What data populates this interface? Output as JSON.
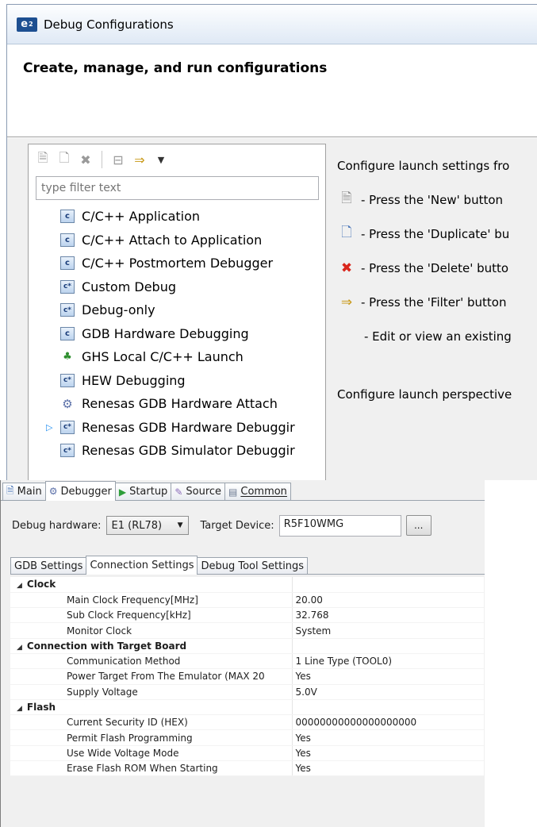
{
  "dialog": {
    "title": "Debug Configurations",
    "header": "Create, manage, and run configurations",
    "filter_placeholder": "type filter text",
    "config_types": [
      {
        "label": "C/C++ Application",
        "icon": "c-config-icon",
        "expandable": false
      },
      {
        "label": "C/C++ Attach to Application",
        "icon": "c-config-icon",
        "expandable": false
      },
      {
        "label": "C/C++ Postmortem Debugger",
        "icon": "c-config-icon",
        "expandable": false
      },
      {
        "label": "Custom Debug",
        "icon": "c-star-config-icon",
        "expandable": false
      },
      {
        "label": "Debug-only",
        "icon": "c-star-config-icon",
        "expandable": false
      },
      {
        "label": "GDB Hardware Debugging",
        "icon": "c-config-icon",
        "expandable": false
      },
      {
        "label": "GHS Local C/C++ Launch",
        "icon": "ghs-icon",
        "expandable": false
      },
      {
        "label": "HEW Debugging",
        "icon": "c-star-config-icon",
        "expandable": false
      },
      {
        "label": "Renesas GDB Hardware Attach",
        "icon": "gear-icon",
        "expandable": false
      },
      {
        "label": "Renesas GDB Hardware Debuggir",
        "icon": "c-star-config-icon",
        "expandable": true
      },
      {
        "label": "Renesas GDB Simulator Debuggir",
        "icon": "c-star-config-icon",
        "expandable": false
      }
    ],
    "hints": {
      "title": "Configure launch settings fro",
      "new": "- Press the 'New' button",
      "duplicate": "- Press the 'Duplicate' bu",
      "delete": "- Press the 'Delete' butto",
      "filter": "- Press the 'Filter' button",
      "edit": "- Edit or view an existing",
      "perspectives": "Configure launch perspective"
    }
  },
  "tabs": {
    "main": "Main",
    "debugger": "Debugger",
    "startup": "Startup",
    "source": "Source",
    "common": "Common"
  },
  "debugger": {
    "hw_label": "Debug hardware:",
    "hw_value": "E1 (RL78)",
    "device_label": "Target Device:",
    "device_value": "R5F10WMG",
    "browse_label": "...",
    "subtabs": {
      "gdb": "GDB Settings",
      "connection": "Connection Settings",
      "debug_tool": "Debug Tool Settings"
    },
    "groups": [
      {
        "name": "Clock",
        "rows": [
          {
            "key": "Main Clock Frequency[MHz]",
            "value": "20.00"
          },
          {
            "key": "Sub Clock Frequency[kHz]",
            "value": "32.768"
          },
          {
            "key": "Monitor Clock",
            "value": "System"
          }
        ]
      },
      {
        "name": "Connection with Target Board",
        "rows": [
          {
            "key": "Communication Method",
            "value": "1 Line Type (TOOL0)"
          },
          {
            "key": "Power Target From The Emulator (MAX 20",
            "value": "Yes"
          },
          {
            "key": "Supply Voltage",
            "value": "5.0V"
          }
        ]
      },
      {
        "name": "Flash",
        "rows": [
          {
            "key": "Current Security ID (HEX)",
            "value": "00000000000000000000"
          },
          {
            "key": "Permit Flash Programming",
            "value": "Yes"
          },
          {
            "key": "Use Wide Voltage Mode",
            "value": "Yes"
          },
          {
            "key": "Erase Flash ROM When Starting",
            "value": "Yes"
          }
        ]
      }
    ]
  }
}
